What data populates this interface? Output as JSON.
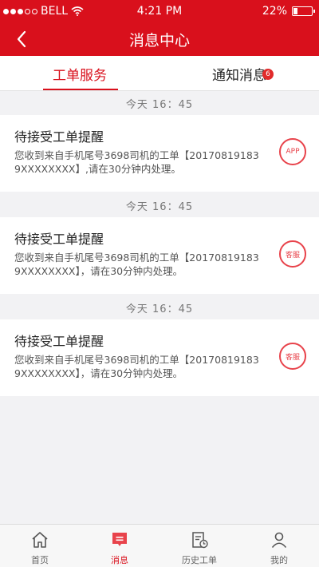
{
  "status_bar": {
    "carrier": "BELL",
    "time": "4:21 PM",
    "battery": "22%",
    "battery_level": 0.22
  },
  "nav": {
    "title": "消息中心"
  },
  "tabs": [
    {
      "label": "工单服务",
      "active": true
    },
    {
      "label": "通知消息",
      "badge": "6"
    }
  ],
  "messages": [
    {
      "time": "今天  16：45",
      "title": "待接受工单提醒",
      "desc": "您收到来自手机尾号3698司机的工单【201708191839XXXXXXXX】,请在30分钟内处理。",
      "stamp": "APP"
    },
    {
      "time": "今天  16：45",
      "title": "待接受工单提醒",
      "desc": "您收到来自手机尾号3698司机的工单【201708191839XXXXXXXX】，请在30分钟内处理。",
      "stamp": "客服"
    },
    {
      "time": "今天  16：45",
      "title": "待接受工单提醒",
      "desc": "您收到来自手机尾号3698司机的工单【201708191839XXXXXXXX】，请在30分钟内处理。",
      "stamp": "客服"
    }
  ],
  "tabbar": [
    {
      "label": "首页",
      "icon": "home-icon"
    },
    {
      "label": "消息",
      "icon": "message-icon",
      "active": true
    },
    {
      "label": "历史工单",
      "icon": "history-icon"
    },
    {
      "label": "我的",
      "icon": "profile-icon"
    }
  ],
  "colors": {
    "brand": "#d9101c",
    "stamp": "#e8434b"
  }
}
